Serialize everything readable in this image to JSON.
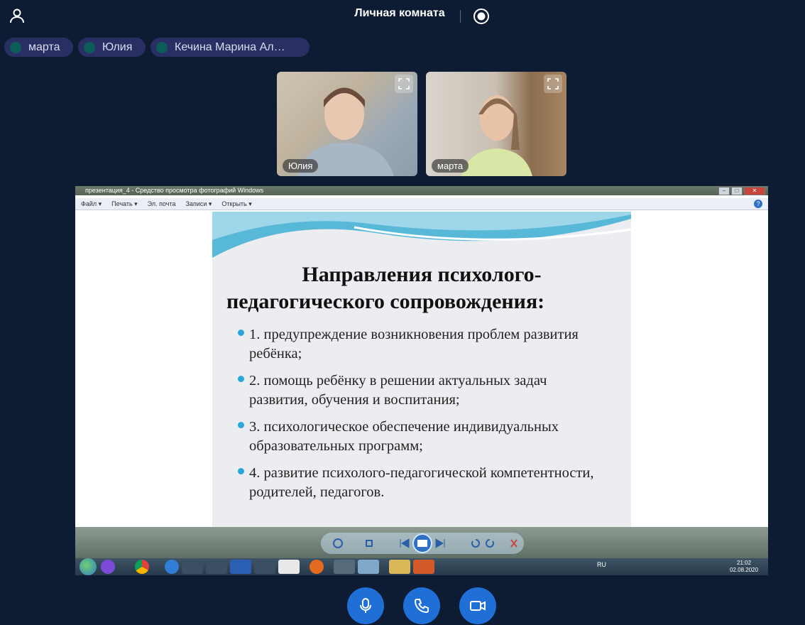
{
  "header": {
    "title": "Личная комната"
  },
  "participants": [
    {
      "name": "марта"
    },
    {
      "name": "Юлия"
    },
    {
      "name": "Кечина Марина Ал…"
    }
  ],
  "videos": [
    {
      "name": "Юлия"
    },
    {
      "name": "марта"
    }
  ],
  "shared_screen": {
    "window_title": "презентация_4 - Средство просмотра фотографий Windows",
    "menu": [
      "Файл ▾",
      "Печать ▾",
      "Эл. почта",
      "Записи ▾",
      "Открыть ▾"
    ],
    "slide": {
      "title_line1": "Направления психолого-",
      "title_line2": "педагогического  сопровождения:",
      "items": [
        "1. предупреждение возникновения проблем развития ребёнка;",
        "2. помощь ребёнку в решении актуальных задач развития, обучения и воспитания;",
        "3. психологическое обеспечение индивидуальных образовательных программ;",
        "4. развитие психолого-педагогической компетентности, родителей, педагогов."
      ]
    },
    "taskbar": {
      "language": "RU",
      "time": "21:02",
      "date": "02.08.2020"
    }
  },
  "icons": {
    "user": "user-icon",
    "record": "record-icon",
    "microphone": "microphone-icon",
    "phone": "phone-icon",
    "camera": "camera-icon",
    "expand": "expand-icon"
  }
}
